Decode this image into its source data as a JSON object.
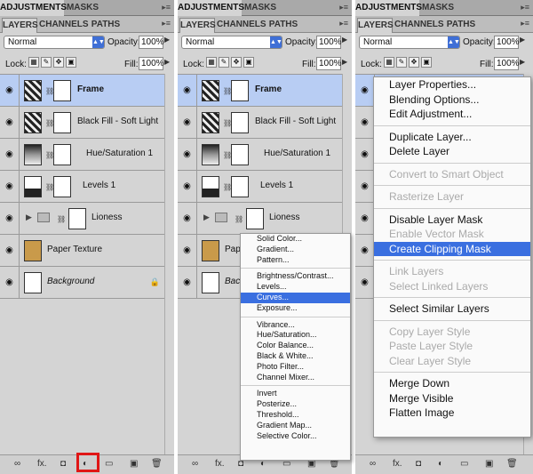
{
  "tabs_top": [
    "ADJUSTMENTS",
    "MASKS"
  ],
  "tabs_layers": [
    "LAYERS",
    "CHANNELS",
    "PATHS"
  ],
  "panel_menu_icon": "panel-menu-icon",
  "blend_mode": "Normal",
  "opacity_label": "Opacity:",
  "opacity_value": "100%",
  "lock_label": "Lock:",
  "fill_label": "Fill:",
  "fill_value": "100%",
  "layers": [
    {
      "name": "Frame",
      "selected": true
    },
    {
      "name": "Black Fill - Soft Light",
      "selected": false
    },
    {
      "name": "Hue/Saturation 1",
      "selected": false
    },
    {
      "name": "Levels 1",
      "selected": false
    },
    {
      "name": "Lioness",
      "selected": false
    },
    {
      "name": "Paper Texture",
      "selected": false
    },
    {
      "name": "Background",
      "selected": false
    }
  ],
  "bottom_icons": [
    "link-icon",
    "fx-icon",
    "mask-icon",
    "adjustment-icon",
    "folder-icon",
    "new-layer-icon",
    "trash-icon"
  ],
  "adjustment_menu": {
    "groups": [
      [
        "Solid Color...",
        "Gradient...",
        "Pattern..."
      ],
      [
        "Brightness/Contrast...",
        "Levels...",
        "Curves...",
        "Exposure..."
      ],
      [
        "Vibrance...",
        "Hue/Saturation...",
        "Color Balance...",
        "Black & White...",
        "Photo Filter...",
        "Channel Mixer..."
      ],
      [
        "Invert",
        "Posterize...",
        "Threshold...",
        "Gradient Map...",
        "Selective Color..."
      ]
    ],
    "highlighted": "Curves..."
  },
  "context_menu": {
    "groups": [
      [
        {
          "label": "Layer Properties...",
          "enabled": true
        },
        {
          "label": "Blending Options...",
          "enabled": true
        },
        {
          "label": "Edit Adjustment...",
          "enabled": true
        }
      ],
      [
        {
          "label": "Duplicate Layer...",
          "enabled": true
        },
        {
          "label": "Delete Layer",
          "enabled": true
        }
      ],
      [
        {
          "label": "Convert to Smart Object",
          "enabled": false
        }
      ],
      [
        {
          "label": "Rasterize Layer",
          "enabled": false
        }
      ],
      [
        {
          "label": "Disable Layer Mask",
          "enabled": true
        },
        {
          "label": "Enable Vector Mask",
          "enabled": false
        },
        {
          "label": "Create Clipping Mask",
          "enabled": true
        }
      ],
      [
        {
          "label": "Link Layers",
          "enabled": false
        },
        {
          "label": "Select Linked Layers",
          "enabled": false
        }
      ],
      [
        {
          "label": "Select Similar Layers",
          "enabled": true
        }
      ],
      [
        {
          "label": "Copy Layer Style",
          "enabled": false
        },
        {
          "label": "Paste Layer Style",
          "enabled": false
        },
        {
          "label": "Clear Layer Style",
          "enabled": false
        }
      ],
      [
        {
          "label": "Merge Down",
          "enabled": true
        },
        {
          "label": "Merge Visible",
          "enabled": true
        },
        {
          "label": "Flatten Image",
          "enabled": true
        }
      ]
    ],
    "highlighted": "Create Clipping Mask"
  },
  "colors": {
    "selection": "#3a6fe0",
    "selected_row": "#b8cdf3",
    "highlight_box": "#e01616"
  }
}
